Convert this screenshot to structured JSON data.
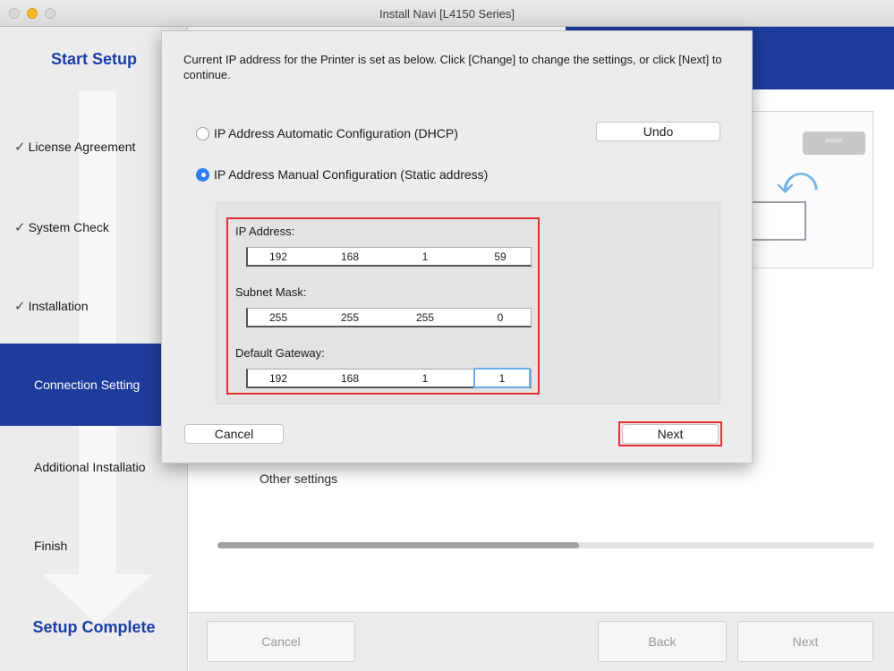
{
  "window": {
    "title": "Install Navi [L4150 Series]"
  },
  "sidebar": {
    "start_heading": "Start Setup",
    "complete_heading": "Setup Complete",
    "steps": [
      {
        "label": "License Agreement",
        "done": true
      },
      {
        "label": "System Check",
        "done": true
      },
      {
        "label": "Installation",
        "done": true
      },
      {
        "label": "Connection Setting",
        "active": true
      },
      {
        "label": "Additional Installatio"
      },
      {
        "label": "Finish"
      }
    ],
    "check_glyph": "✓"
  },
  "background": {
    "other_settings": "Other settings",
    "progress_fraction": 0.55,
    "printer_label": "EPSON",
    "buttons": {
      "cancel": "Cancel",
      "back": "Back",
      "next": "Next"
    }
  },
  "dialog": {
    "message": "Current IP address for the Printer is set as below. Click [Change] to change the settings, or click [Next] to continue.",
    "dhcp_label": "IP Address Automatic Configuration (DHCP)",
    "static_label": "IP Address Manual Configuration (Static address)",
    "selected_mode": "static",
    "undo_label": "Undo",
    "ip_label": "IP Address:",
    "ip": [
      "192",
      "168",
      "1",
      "59"
    ],
    "subnet_label": "Subnet Mask:",
    "subnet": [
      "255",
      "255",
      "255",
      "0"
    ],
    "gateway_label": "Default Gateway:",
    "gateway": [
      "192",
      "168",
      "1",
      "1"
    ],
    "cancel_label": "Cancel",
    "next_label": "Next"
  },
  "colors": {
    "accent_blue": "#1e3c9c",
    "highlight_red": "#e03030",
    "radio_selected": "#2d7df6"
  }
}
